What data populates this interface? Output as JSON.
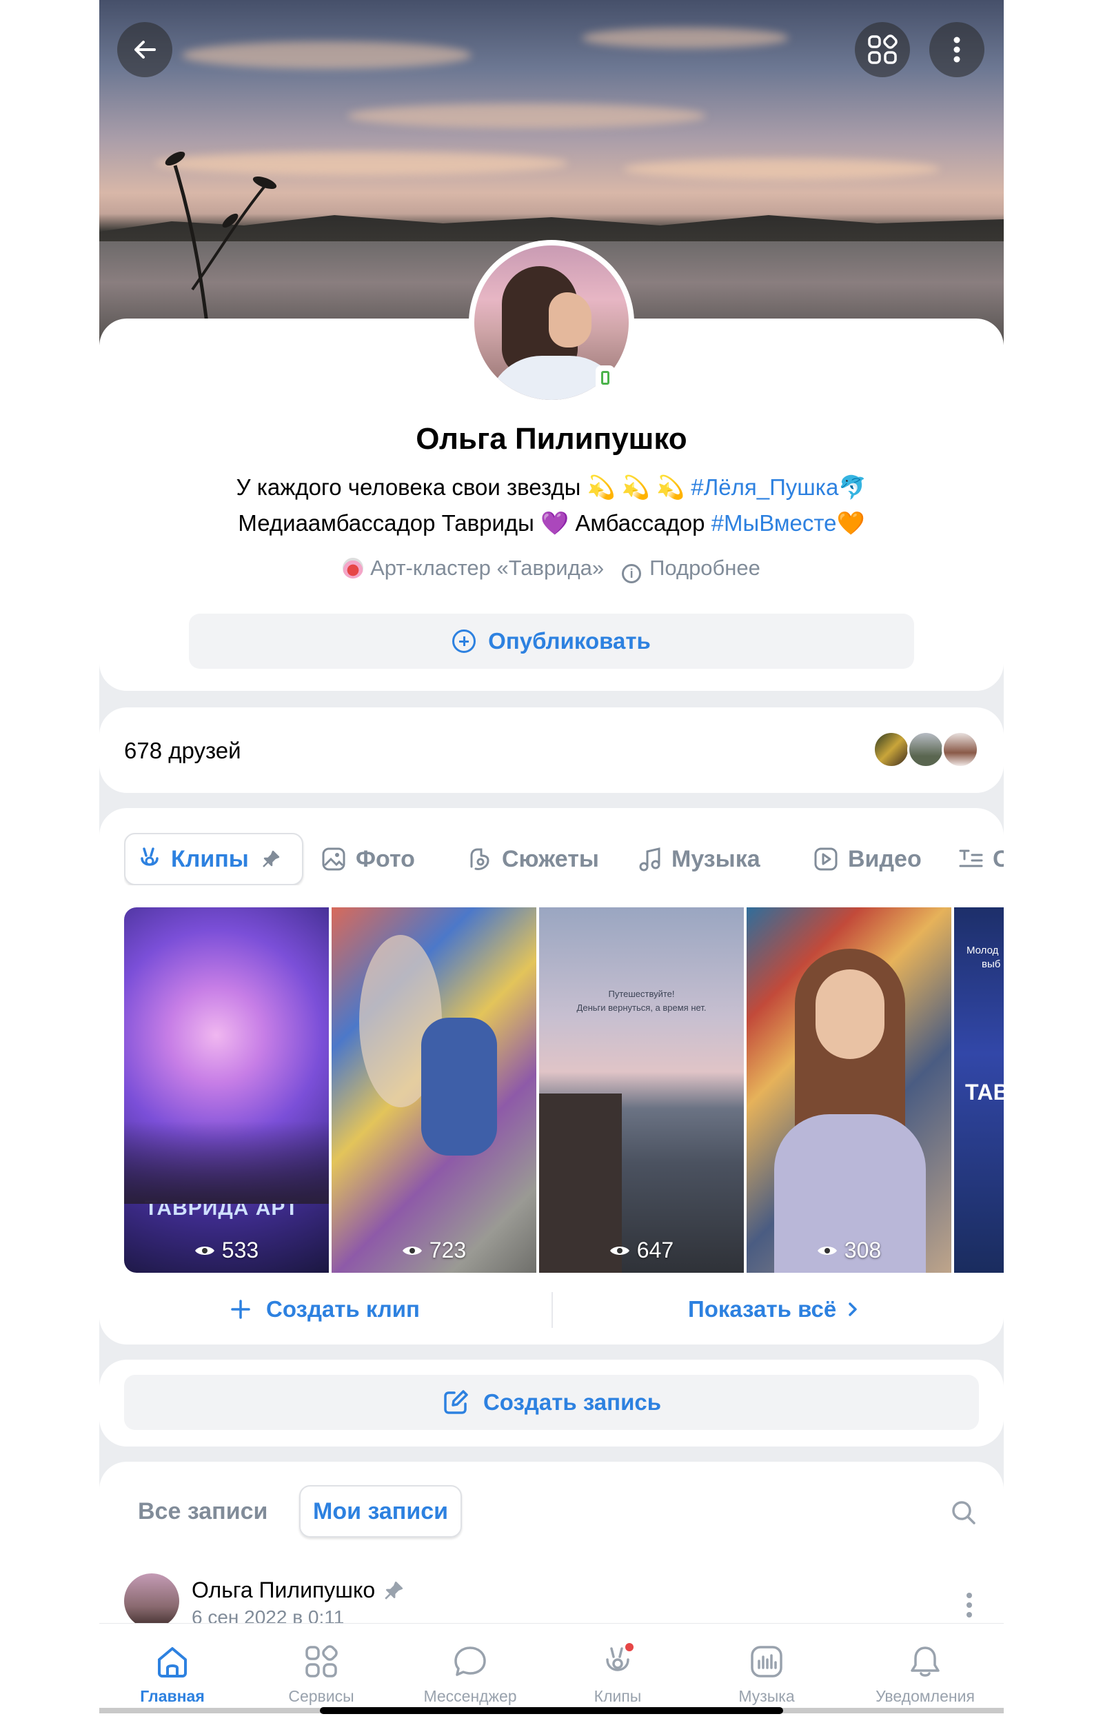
{
  "profile": {
    "name": "Ольга Пилипушко",
    "status_line1_text": "У каждого человека свои звезды 💫 💫 💫 ",
    "status_line1_tag": "#Лёля_Пушка",
    "status_line1_emoji": "🐬",
    "status_line2_text": "Медиаамбассадор Тавриды 💜 Амбассадор ",
    "status_line2_tag": "#МыВместе",
    "status_line2_emoji": "🧡",
    "workplace": "Арт-кластер «Таврида»",
    "more_label": "Подробнее",
    "publish_label": "Опубликовать"
  },
  "friends": {
    "label": "678 друзей"
  },
  "media_tabs": [
    {
      "label": "Клипы",
      "active": true
    },
    {
      "label": "Фото"
    },
    {
      "label": "Сюжеты"
    },
    {
      "label": "Музыка"
    },
    {
      "label": "Видео"
    },
    {
      "label": "С"
    }
  ],
  "clips": [
    {
      "views": "533",
      "overlay": "ТАВРИДА АРТ"
    },
    {
      "views": "723"
    },
    {
      "views": "647",
      "caption1": "Путешествуйте!",
      "caption2": "Деньги вернуться, а время нет."
    },
    {
      "views": "308"
    },
    {
      "views": "",
      "overlay": "ТАВ",
      "caption1": "Молод",
      "caption2": "выб"
    }
  ],
  "clip_actions": {
    "create_label": "Создать клип",
    "show_all_label": "Показать всё"
  },
  "create_post": {
    "label": "Создать запись"
  },
  "posts": {
    "tab_all": "Все записи",
    "tab_mine": "Мои записи",
    "author": "Ольга Пилипушко",
    "date": "6 сен 2022 в 0:11"
  },
  "tabbar": [
    {
      "label": "Главная",
      "icon": "home-icon",
      "active": true
    },
    {
      "label": "Сервисы",
      "icon": "services-icon"
    },
    {
      "label": "Мессенджер",
      "icon": "messenger-icon"
    },
    {
      "label": "Клипы",
      "icon": "clips-icon"
    },
    {
      "label": "Музыка",
      "icon": "music-icon"
    },
    {
      "label": "Уведомления",
      "icon": "bell-icon"
    }
  ],
  "colors": {
    "accent": "#2d81e0",
    "secondary_text": "#818c99",
    "background": "#ebedf0"
  }
}
